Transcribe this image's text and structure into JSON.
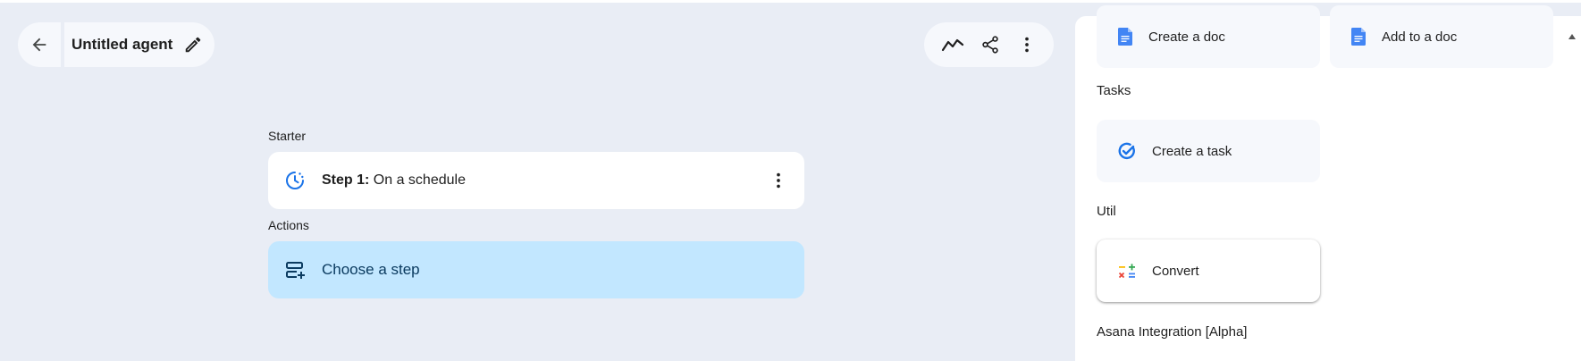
{
  "header": {
    "title": "Untitled agent"
  },
  "flow": {
    "starter_label": "Starter",
    "step1_prefix": "Step 1:",
    "step1_name": "On a schedule",
    "actions_label": "Actions",
    "choose_step": "Choose a step"
  },
  "panel": {
    "docs": [
      "Create a doc",
      "Add to a doc"
    ],
    "tasks_heading": "Tasks",
    "tasks": [
      "Create a task"
    ],
    "util_heading": "Util",
    "util": [
      "Convert"
    ],
    "asana_heading": "Asana Integration [Alpha]"
  },
  "colors": {
    "background": "#e9edf5",
    "choose_step_bg": "#c2e7ff",
    "google_blue": "#4285f4",
    "accent_blue": "#1a73e8"
  },
  "icons": {
    "back": "arrow-left-icon",
    "edit": "pencil-icon",
    "activity": "activity-line-icon",
    "share": "share-icon",
    "more": "more-vert-icon",
    "schedule": "schedule-icon",
    "add_step": "add-step-icon",
    "doc": "google-doc-icon",
    "task": "task-check-icon",
    "convert": "calculator-icon"
  }
}
